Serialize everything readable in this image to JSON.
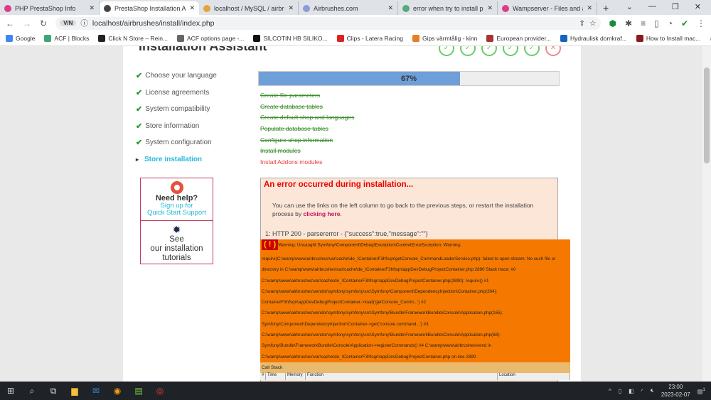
{
  "browser": {
    "tabs": [
      {
        "label": "PHP PrestaShop Info",
        "color": "#e0398a"
      },
      {
        "label": "PrestaShop Installation Assistant",
        "color": "#444",
        "active": true
      },
      {
        "label": "localhost / MySQL / airbrushes",
        "color": "#e6a23c"
      },
      {
        "label": "Airbrushes.com",
        "color": "#8a9bd8"
      },
      {
        "label": "error when try to install prestashop",
        "color": "#5a7"
      },
      {
        "label": "Wampserver - Files and addons",
        "color": "#e0398a"
      }
    ],
    "new_tab": "+",
    "vpn": "V/N",
    "url": "localhost/airbrushes/install/index.php",
    "bookmarks": [
      "Google",
      "ACF | Blocks",
      "Click N Store – Rein...",
      "ACF options page -...",
      "SILCOTIN HB SILIKO...",
      "Clips - Latera Racing",
      "Gips värmtålig - kinn",
      "European provider...",
      "Hydraulisk domkraf...",
      "How to Install mac..."
    ],
    "more": "»"
  },
  "page": {
    "title": "Installation Assistant",
    "steps": [
      {
        "label": "Choose your language",
        "done": true
      },
      {
        "label": "License agreements",
        "done": true
      },
      {
        "label": "System compatibility",
        "done": true
      },
      {
        "label": "Store information",
        "done": true
      },
      {
        "label": "System configuration",
        "done": true
      },
      {
        "label": "Store installation",
        "current": true
      }
    ],
    "help": {
      "title": "Need help?",
      "link1": "Sign up for",
      "link2": "Quick Start Support",
      "see": "See",
      "tutorials1": "our installation",
      "tutorials2": "tutorials"
    },
    "progress": {
      "value": 67,
      "label": "67%"
    },
    "tasks": [
      {
        "label": "Create file parameters",
        "done": true
      },
      {
        "label": "Create database tables",
        "done": true
      },
      {
        "label": "Create default shop and languages",
        "done": true
      },
      {
        "label": "Populate database tables",
        "done": true
      },
      {
        "label": "Configure shop information",
        "done": true
      },
      {
        "label": "Install modules",
        "done": true
      },
      {
        "label": "Install Addons modules",
        "done": false
      }
    ],
    "error": {
      "title": "An error occurred during installation...",
      "text": "You can use the links on the left column to go back to the previous steps, or restart the installation process by ",
      "link": "clicking here",
      "after": ".",
      "http": "1: HTTP 200 - parsererror - {\"success\":true,\"message\":\"\"}"
    },
    "xdebug": {
      "badge": "( ! )",
      "lines": [
        "Warning: Uncaught Symfony\\Component\\Debug\\Exception\\ContextErrorException: Warning:",
        "require(C:\\wamp\\www\\airbrushes\\var\\cache\\de_\\ContainerF3hfsqn\\getConsole_CommandLoaderService.php): failed to open stream: No such file or",
        "directory in C:\\wamp\\www\\airbrushes\\var\\cache\\de_\\ContainerF3hfsqn\\appDevDebugProjectContainer.php:2890 Stack trace: #0",
        "C:\\wamp\\www\\airbrushes\\var\\cache\\de_\\ContainerF3hfsqn\\appDevDebugProjectContainer.php(2890): require() #1",
        "C:\\wamp\\www\\airbrushes\\vendor\\symfony\\symfony\\src\\Symfony\\Component\\DependencyInjection\\Container.php(304):",
        "ContainerF3hfsqn\\appDevDebugProjectContainer->load('getConsole_Comm...') #2",
        "C:\\wamp\\www\\airbrushes\\vendor\\symfony\\symfony\\src\\Symfony\\Bundle\\FrameworkBundle\\Console\\Application.php(165):",
        "Symfony\\Component\\DependencyInjection\\Container->get('console.command...') #3",
        "C:\\wamp\\www\\airbrushes\\vendor\\symfony\\symfony\\src\\Symfony\\Bundle\\FrameworkBundle\\Console\\Application.php(68):",
        "Symfony\\Bundle\\FrameworkBundle\\Console\\Application->registerCommands() #4 C:\\wamp\\www\\airbrushes\\vend in",
        "C:\\wamp\\www\\airbrushes\\var\\cache\\de_\\ContainerF3hfsqn\\appDevDebugProjectContainer.php on line 2890"
      ],
      "call_stack": "Call Stack",
      "columns": [
        "#",
        "Time",
        "Memory",
        "Function",
        "Location"
      ]
    }
  },
  "taskbar": {
    "time": "23:00",
    "date": "2023-02-07",
    "notifications": "1"
  }
}
